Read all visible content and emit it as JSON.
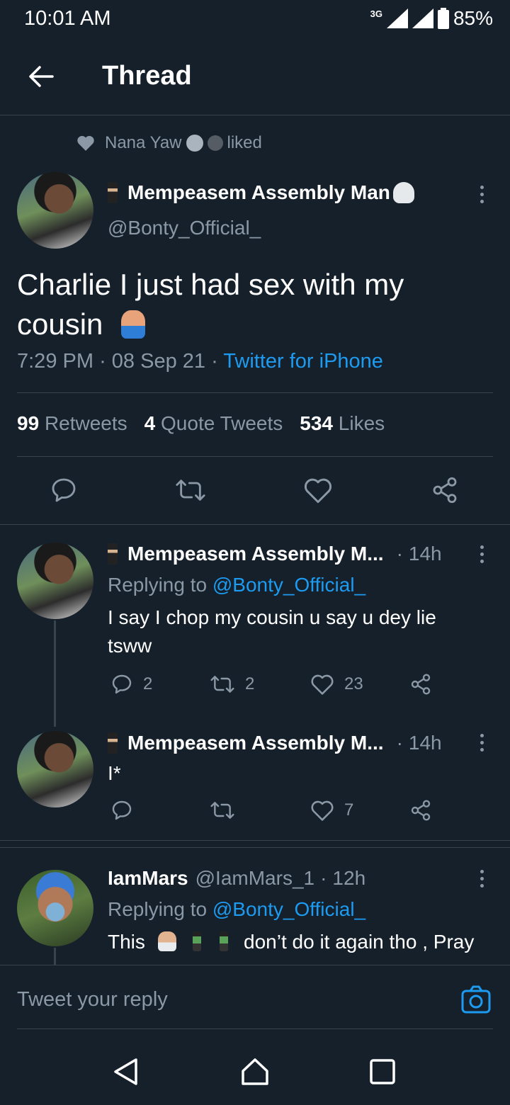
{
  "status_bar": {
    "time": "10:01 AM",
    "network": "3G",
    "battery": "85%"
  },
  "header": {
    "title": "Thread"
  },
  "social_context": {
    "name": "Nana Yaw",
    "action": "liked"
  },
  "main_tweet": {
    "display_name": "Mempeasem Assembly Man",
    "handle": "@Bonty_Official_",
    "text": "Charlie I just had sex with my cousin",
    "time": "7:29 PM",
    "date": "08 Sep 21",
    "source": "Twitter for iPhone",
    "retweets_count": "99",
    "retweets_label": "Retweets",
    "quotes_count": "4",
    "quotes_label": "Quote Tweets",
    "likes_count": "534",
    "likes_label": "Likes"
  },
  "replies": [
    {
      "display_name": "Mempeasem Assembly M...",
      "age": "14h",
      "replying_prefix": "Replying to",
      "replying_to": "@Bonty_Official_",
      "text": "I say I chop my cousin u say u dey lie tsww",
      "reply_count": "2",
      "retweet_count": "2",
      "like_count": "23"
    },
    {
      "display_name": "Mempeasem Assembly M...",
      "age": "14h",
      "text": "I*",
      "reply_count": "",
      "retweet_count": "",
      "like_count": "7"
    },
    {
      "display_name": "IamMars",
      "handle": "@IamMars_1",
      "age": "12h",
      "replying_prefix": "Replying to",
      "replying_to": "@Bonty_Official_",
      "text": "This",
      "text_after": "don’t do it again tho , Pray"
    }
  ],
  "composer": {
    "placeholder": "Tweet your reply"
  },
  "colors": {
    "background": "#15202b",
    "accent": "#1d9bf0",
    "muted": "#8b98a5",
    "divider": "#38444d"
  },
  "icons": [
    "back-arrow-icon",
    "heart-icon",
    "more-icon",
    "reply-icon",
    "retweet-icon",
    "like-icon",
    "share-icon",
    "camera-icon",
    "nav-back-icon",
    "nav-home-icon",
    "nav-recents-icon"
  ]
}
